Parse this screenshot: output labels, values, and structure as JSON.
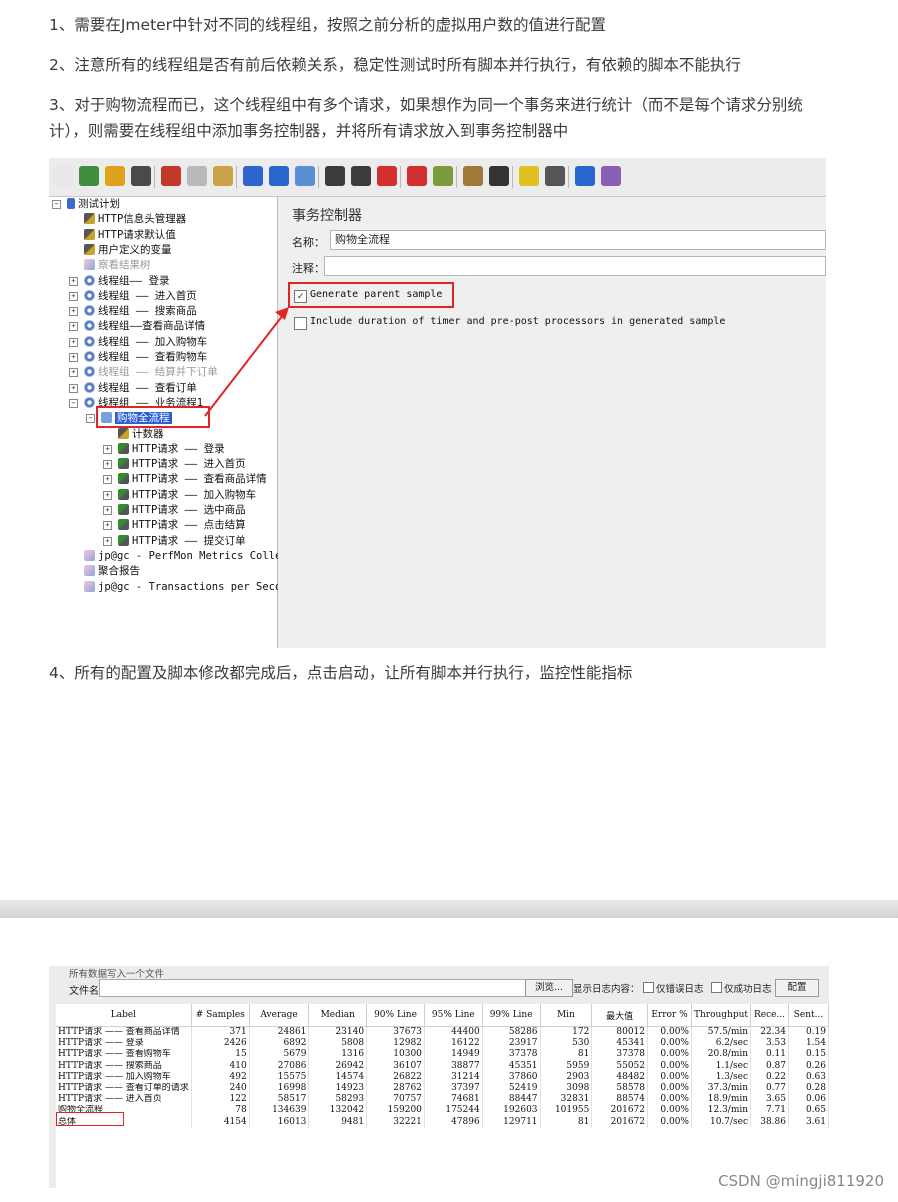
{
  "article": {
    "p1": "1、需要在Jmeter中针对不同的线程组，按照之前分析的虚拟用户数的值进行配置",
    "p2": "2、注意所有的线程组是否有前后依赖关系，稳定性测试时所有脚本并行执行，有依赖的脚本不能执行",
    "p3": "3、对于购物流程而已，这个线程组中有多个请求，如果想作为同一个事务来进行统计（而不是每个请求分别统计），则需要在线程组中添加事务控制器，并将所有请求放入到事务控制器中",
    "p4": "4、所有的配置及脚本修改都完成后，点击启动，让所有脚本并行执行，监控性能指标"
  },
  "jmeter": {
    "tree": [
      {
        "label": "测试计划",
        "icon": "flask-icon",
        "level": 0,
        "exp": "⊟"
      },
      {
        "label": "HTTP信息头管理器",
        "icon": "tool-icon",
        "level": 1
      },
      {
        "label": "HTTP请求默认值",
        "icon": "tool-icon",
        "level": 1
      },
      {
        "label": "用户定义的变量",
        "icon": "tool-icon",
        "level": 1
      },
      {
        "label": "察看结果树",
        "icon": "graph-icon",
        "level": 1,
        "dim": true
      },
      {
        "label": "线程组—— 登录",
        "icon": "gear-icon",
        "level": 1,
        "exp": "⊞"
      },
      {
        "label": "线程组 —— 进入首页",
        "icon": "gear-icon",
        "level": 1,
        "exp": "⊞"
      },
      {
        "label": "线程组 —— 搜索商品",
        "icon": "gear-icon",
        "level": 1,
        "exp": "⊞"
      },
      {
        "label": "线程组——查看商品详情",
        "icon": "gear-icon",
        "level": 1,
        "exp": "⊞"
      },
      {
        "label": "线程组 —— 加入购物车",
        "icon": "gear-icon",
        "level": 1,
        "exp": "⊞"
      },
      {
        "label": "线程组 —— 查看购物车",
        "icon": "gear-icon",
        "level": 1,
        "exp": "⊞"
      },
      {
        "label": "线程组 —— 结算并下订单",
        "icon": "gear-icon",
        "level": 1,
        "exp": "⊞",
        "dim": true
      },
      {
        "label": "线程组 —— 查看订单",
        "icon": "gear-icon",
        "level": 1,
        "exp": "⊞"
      },
      {
        "label": "线程组 —— 业务流程1",
        "icon": "gear-icon",
        "level": 1,
        "exp": "⊟"
      },
      {
        "label": "购物全流程",
        "icon": "controller-icon",
        "level": 2,
        "exp": "⊟",
        "selected": true
      },
      {
        "label": "计数器",
        "icon": "tool-icon",
        "level": 3
      },
      {
        "label": "HTTP请求 —— 登录",
        "icon": "pen-icon",
        "level": 3,
        "exp": "⊞"
      },
      {
        "label": "HTTP请求 —— 进入首页",
        "icon": "pen-icon",
        "level": 3,
        "exp": "⊞"
      },
      {
        "label": "HTTP请求 —— 查看商品详情",
        "icon": "pen-icon",
        "level": 3,
        "exp": "⊞"
      },
      {
        "label": "HTTP请求 —— 加入购物车",
        "icon": "pen-icon",
        "level": 3,
        "exp": "⊞"
      },
      {
        "label": "HTTP请求 —— 选中商品",
        "icon": "pen-icon",
        "level": 3,
        "exp": "⊞"
      },
      {
        "label": "HTTP请求 —— 点击结算",
        "icon": "pen-icon",
        "level": 3,
        "exp": "⊞"
      },
      {
        "label": "HTTP请求 —— 提交订单",
        "icon": "pen-icon",
        "level": 3,
        "exp": "⊞"
      },
      {
        "label": "jp@gc - PerfMon Metrics Collector",
        "icon": "graph-icon",
        "level": 1
      },
      {
        "label": "聚合报告",
        "icon": "graph-icon",
        "level": 1
      },
      {
        "label": "jp@gc - Transactions per Second",
        "icon": "graph-icon",
        "level": 1
      }
    ],
    "panel": {
      "title": "事务控制器",
      "name_label": "名称：",
      "name_value": "购物全流程",
      "comment_label": "注释：",
      "cb1": "Generate parent sample",
      "cb1_checked": true,
      "cb2": "Include duration of timer and pre-post processors in generated sample",
      "cb2_checked": false
    },
    "toolbar_colors": [
      "#e9e9e9",
      "#3e8e3e",
      "#e0a21a",
      "#4a4a4a",
      "#c0392b",
      "#b9b9b9",
      "#caa24a",
      "#2b66cc",
      "#2b66cc",
      "#5a8fd6",
      "#3c3c3c",
      "#3c3c3c",
      "#d32f2f",
      "#d32f2f",
      "#7a9c3a",
      "#a07a3a",
      "#333333",
      "#e0c020",
      "#555555",
      "#2b66cc",
      "#8a5fb8"
    ]
  },
  "aggregate": {
    "top_text": "所有数据写入一个文件",
    "file_label": "文件名",
    "browse": "浏览...",
    "log_label": "显示日志内容：",
    "err_only": "仅错误日志",
    "ok_only": "仅成功日志",
    "config": "配置",
    "headers": [
      "Label",
      "# Samples",
      "Average",
      "Median",
      "90% Line",
      "95% Line",
      "99% Line",
      "Min",
      "最大值",
      "Error %",
      "Throughput",
      "Rece...",
      "Sent..."
    ],
    "rows": [
      [
        "HTTP请求 —— 查看商品详情",
        "371",
        "24861",
        "23140",
        "37673",
        "44400",
        "58286",
        "172",
        "80012",
        "0.00%",
        "57.5/min",
        "22.34",
        "0.19"
      ],
      [
        "HTTP请求 —— 登录",
        "2426",
        "6892",
        "5808",
        "12982",
        "16122",
        "23917",
        "530",
        "45341",
        "0.00%",
        "6.2/sec",
        "3.53",
        "1.54"
      ],
      [
        "HTTP请求 —— 查看购物车",
        "15",
        "5679",
        "1316",
        "10300",
        "14949",
        "37378",
        "81",
        "37378",
        "0.00%",
        "20.8/min",
        "0.11",
        "0.15"
      ],
      [
        "HTTP请求 —— 搜索商品",
        "410",
        "27086",
        "26942",
        "36107",
        "38877",
        "45351",
        "5959",
        "55052",
        "0.00%",
        "1.1/sec",
        "0.87",
        "0.26"
      ],
      [
        "HTTP请求 —— 加入购物车",
        "492",
        "15575",
        "14574",
        "26822",
        "31214",
        "37860",
        "2903",
        "48482",
        "0.00%",
        "1.3/sec",
        "0.22",
        "0.63"
      ],
      [
        "HTTP请求 —— 查看订单的请求",
        "240",
        "16998",
        "14923",
        "28762",
        "37397",
        "52419",
        "3098",
        "58578",
        "0.00%",
        "37.3/min",
        "0.77",
        "0.28"
      ],
      [
        "HTTP请求 —— 进入首页",
        "122",
        "58517",
        "58293",
        "70757",
        "74681",
        "88447",
        "32831",
        "88574",
        "0.00%",
        "18.9/min",
        "3.65",
        "0.06"
      ],
      [
        "购物全流程",
        "78",
        "134639",
        "132042",
        "159200",
        "175244",
        "192603",
        "101955",
        "201672",
        "0.00%",
        "12.3/min",
        "7.71",
        "0.65"
      ],
      [
        "总体",
        "4154",
        "16013",
        "9481",
        "32221",
        "47896",
        "129711",
        "81",
        "201672",
        "0.00%",
        "10.7/sec",
        "38.86",
        "3.61"
      ]
    ]
  },
  "watermark": "CSDN @mingji811920"
}
